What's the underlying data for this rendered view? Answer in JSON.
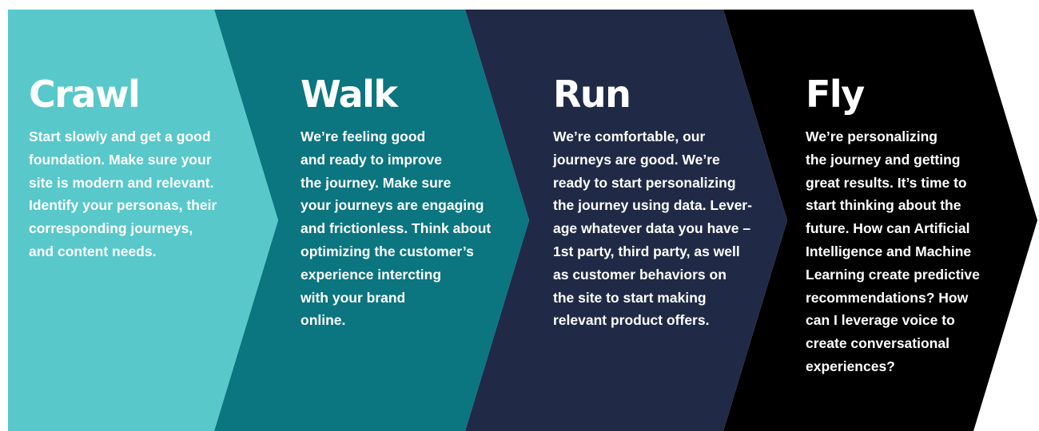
{
  "colors": {
    "crawl": "#58c8ca",
    "walk": "#0b7580",
    "run": "#202a46",
    "fly": "#000000",
    "text": "#ffffff"
  },
  "stages": [
    {
      "title": "Crawl",
      "lines": [
        "Start slowly and get a good",
        "foundation. Make sure your",
        "site is modern and relevant.",
        "Identify your personas, their",
        "corresponding journeys,",
        "and content needs."
      ]
    },
    {
      "title": "Walk",
      "lines": [
        "We’re feeling good",
        "and ready to improve",
        "the journey. Make sure",
        "your journeys are engaging",
        "and frictionless. Think about",
        "optimizing the customer’s",
        "experience intercting",
        "with your brand",
        "online."
      ]
    },
    {
      "title": "Run",
      "lines": [
        "We’re comfortable,  our",
        "journeys are good. We’re",
        "ready to start personalizing",
        "the journey using data. Lever-",
        "age whatever data you have –",
        "1st party, third party, as well",
        "as customer behaviors on",
        "the site to start making",
        "relevant product offers."
      ]
    },
    {
      "title": "Fly",
      "lines": [
        "We’re personalizing",
        "the journey and getting",
        "great results. It’s time to",
        "start thinking about the",
        "future. How can Artificial",
        "Intelligence and Machine",
        "Learning create predictive",
        "recommendations?  How",
        "can I leverage voice to",
        "create conversational",
        "experiences?"
      ]
    }
  ]
}
